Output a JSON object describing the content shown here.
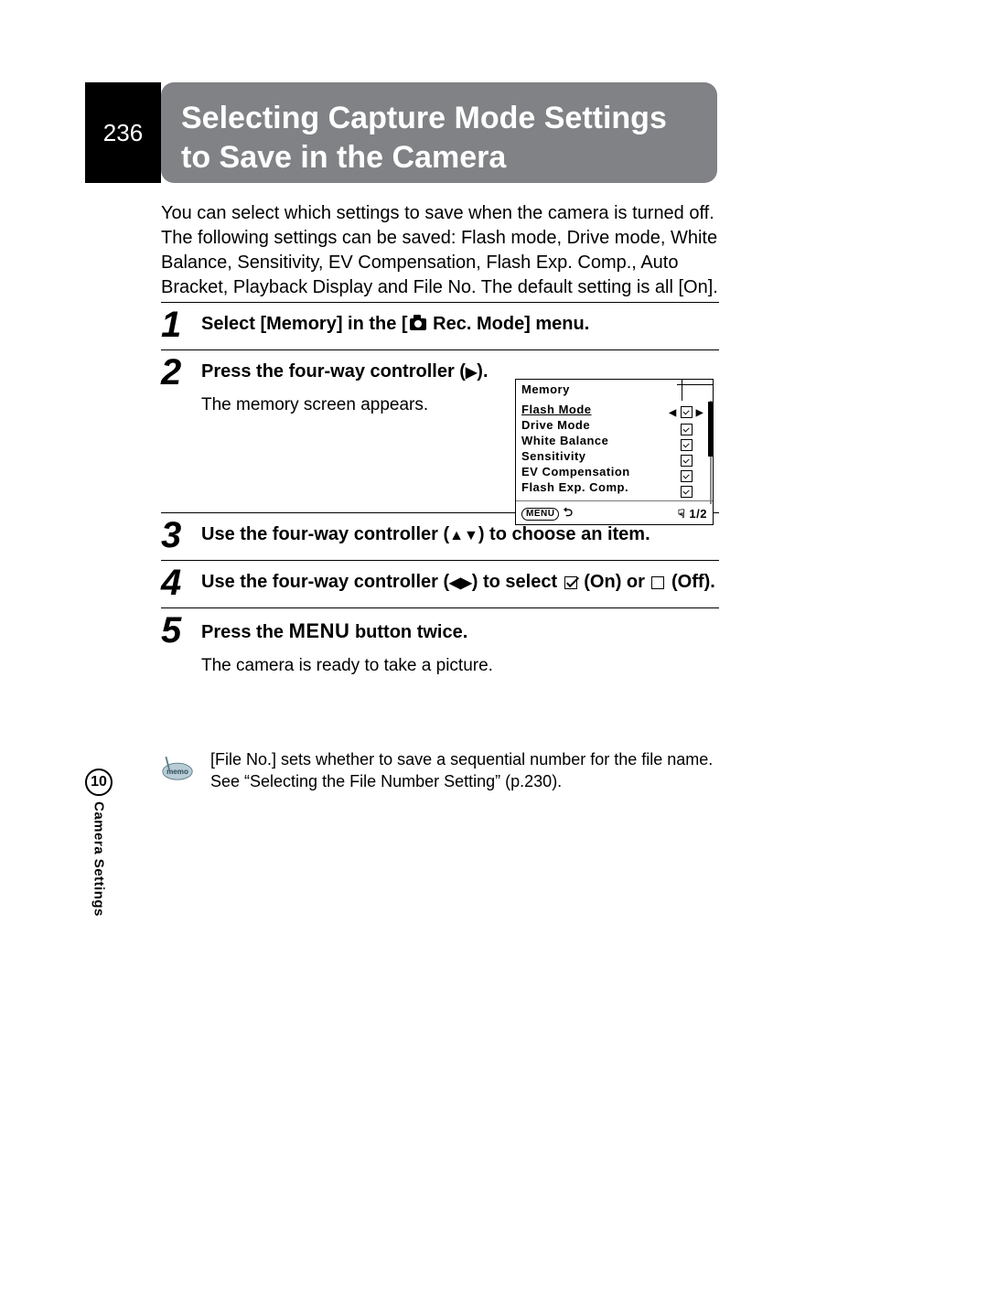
{
  "page_number": "236",
  "title": "Selecting Capture Mode Settings to Save in the Camera",
  "intro": "You can select which settings to save when the camera is turned off. The following settings can be saved: Flash mode, Drive mode, White Balance, Sensitivity, EV Compensation, Flash Exp. Comp., Auto Bracket, Playback Display and File No. The default setting is all [On].",
  "steps": {
    "s1": {
      "num": "1",
      "title_pre": "Select [Memory] in the [",
      "title_post": " Rec. Mode] menu."
    },
    "s2": {
      "num": "2",
      "title_pre": "Press the four-way controller (",
      "title_post": ").",
      "text": "The memory screen appears."
    },
    "s3": {
      "num": "3",
      "title_pre": "Use the four-way controller (",
      "title_post": ") to choose an item."
    },
    "s4": {
      "num": "4",
      "title_pre": "Use the four-way controller (",
      "title_mid": ") to select ",
      "title_on": " (On) or ",
      "title_post": " (Off)."
    },
    "s5": {
      "num": "5",
      "title_pre": "Press the ",
      "menu": "MENU",
      "title_post": " button twice.",
      "text": "The camera is ready to take a picture."
    }
  },
  "camera_screen": {
    "title": "Memory",
    "items": [
      "Flash Mode",
      "Drive Mode",
      "White Balance",
      "Sensitivity",
      "EV Compensation",
      "Flash Exp. Comp."
    ],
    "footer_right": "1/2",
    "footer_left": "MENU"
  },
  "memo": "[File No.] sets whether to save a sequential number for the file name. See “Selecting the File Number Setting” (p.230).",
  "side": {
    "number": "10",
    "label": "Camera Settings"
  }
}
